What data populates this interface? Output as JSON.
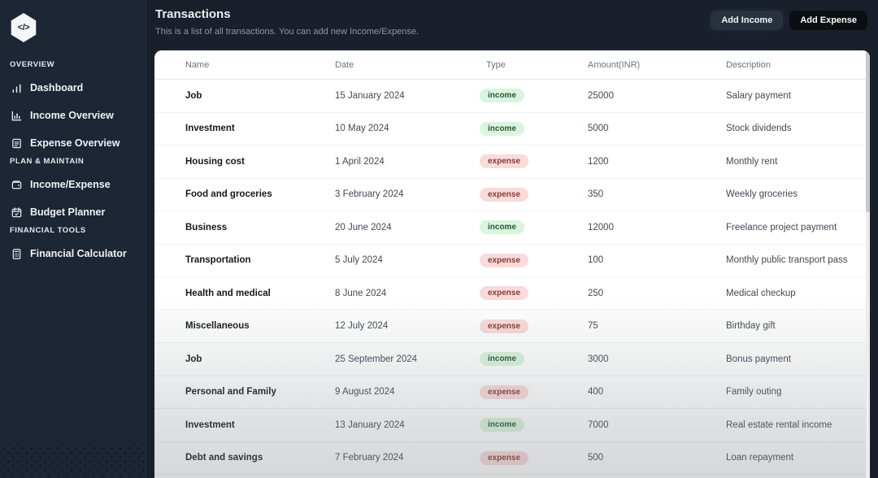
{
  "app": {
    "logo_icon": "code-icon",
    "logo_glyph": "</>"
  },
  "sidebar": {
    "sections": [
      {
        "label": "OVERVIEW",
        "items": [
          {
            "icon": "bar-chart-icon",
            "label": "Dashboard"
          },
          {
            "icon": "chart-column-icon",
            "label": "Income Overview"
          },
          {
            "icon": "report-icon",
            "label": "Expense Overview"
          }
        ]
      },
      {
        "label": "PLAN & MAINTAIN",
        "items": [
          {
            "icon": "wallet-icon",
            "label": "Income/Expense"
          },
          {
            "icon": "calendar-icon",
            "label": "Budget Planner"
          }
        ]
      },
      {
        "label": "FINANCIAL TOOLS",
        "items": [
          {
            "icon": "calculator-icon",
            "label": "Financial Calculator"
          }
        ]
      }
    ]
  },
  "header": {
    "title": "Transactions",
    "subtitle": "This is a list of all transactions. You can add new Income/Expense.",
    "add_income_label": "Add Income",
    "add_expense_label": "Add Expense",
    "cursor_icon": "cursor-arrow-icon"
  },
  "table": {
    "columns": [
      "Name",
      "Date",
      "Type",
      "Amount(INR)",
      "Description"
    ],
    "rows": [
      {
        "name": "Job",
        "date": "15 January 2024",
        "type": "income",
        "amount": "25000",
        "description": "Salary payment"
      },
      {
        "name": "Investment",
        "date": "10 May 2024",
        "type": "income",
        "amount": "5000",
        "description": "Stock dividends"
      },
      {
        "name": "Housing cost",
        "date": "1 April 2024",
        "type": "expense",
        "amount": "1200",
        "description": "Monthly rent"
      },
      {
        "name": "Food and groceries",
        "date": "3 February 2024",
        "type": "expense",
        "amount": "350",
        "description": "Weekly groceries"
      },
      {
        "name": "Business",
        "date": "20 June 2024",
        "type": "income",
        "amount": "12000",
        "description": "Freelance project payment"
      },
      {
        "name": "Transportation",
        "date": "5 July 2024",
        "type": "expense",
        "amount": "100",
        "description": "Monthly public transport pass"
      },
      {
        "name": "Health and medical",
        "date": "8 June 2024",
        "type": "expense",
        "amount": "250",
        "description": "Medical checkup"
      },
      {
        "name": "Miscellaneous",
        "date": "12 July 2024",
        "type": "expense",
        "amount": "75",
        "description": "Birthday gift"
      },
      {
        "name": "Job",
        "date": "25 September 2024",
        "type": "income",
        "amount": "3000",
        "description": "Bonus payment"
      },
      {
        "name": "Personal and Family",
        "date": "9 August 2024",
        "type": "expense",
        "amount": "400",
        "description": "Family outing"
      },
      {
        "name": "Investment",
        "date": "13 January 2024",
        "type": "income",
        "amount": "7000",
        "description": "Real estate rental income"
      },
      {
        "name": "Debt and savings",
        "date": "7 February 2024",
        "type": "expense",
        "amount": "500",
        "description": "Loan repayment"
      }
    ]
  },
  "colors": {
    "sidebar_bg": "#1d2634",
    "page_bg": "#19202b",
    "card_bg": "#ffffff",
    "button_dark_bg": "#0b0e13",
    "income_badge_bg": "#d9f5de",
    "income_badge_text": "#31543a",
    "expense_badge_bg": "#f8dbda",
    "expense_badge_text": "#8a3b35"
  }
}
